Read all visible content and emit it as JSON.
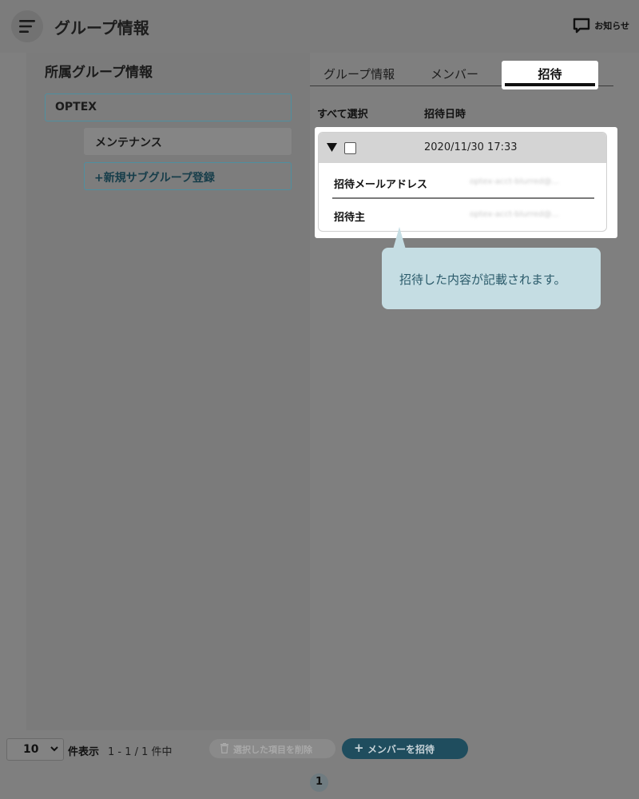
{
  "header": {
    "title": "グループ情報",
    "notice_label": "お知らせ"
  },
  "sidebar": {
    "title": "所属グループ情報",
    "root_group": "OPTEX",
    "subgroups": [
      "メンテナンス"
    ],
    "add_subgroup_label": "+新規サブグループ登録"
  },
  "tabs": [
    {
      "label": "グループ情報",
      "active": false
    },
    {
      "label": "メンバー",
      "active": false
    },
    {
      "label": "招待",
      "active": true
    }
  ],
  "table": {
    "headers": {
      "select_all": "すべて選択",
      "invite_date": "招待日時"
    },
    "rows": [
      {
        "date": "2020/11/30 17:33",
        "email_label": "招待メールアドレス",
        "email_value": "optex-acct-blurred@...",
        "inviter_label": "招待主",
        "inviter_value": "optex-acct-blurred@..."
      }
    ]
  },
  "tooltip": {
    "text": "招待した内容が記載されます。"
  },
  "footer": {
    "per_page_value": "10",
    "per_page_label": "件表示",
    "range": "1 - 1 / 1 件中",
    "delete_label": "選択した項目を削除",
    "invite_label": "メンバーを招待",
    "current_page": "1"
  },
  "colors": {
    "accent": "#1f4d5e",
    "tooltip_bg": "#c5dde3",
    "overlay": "#7f7f7f"
  }
}
